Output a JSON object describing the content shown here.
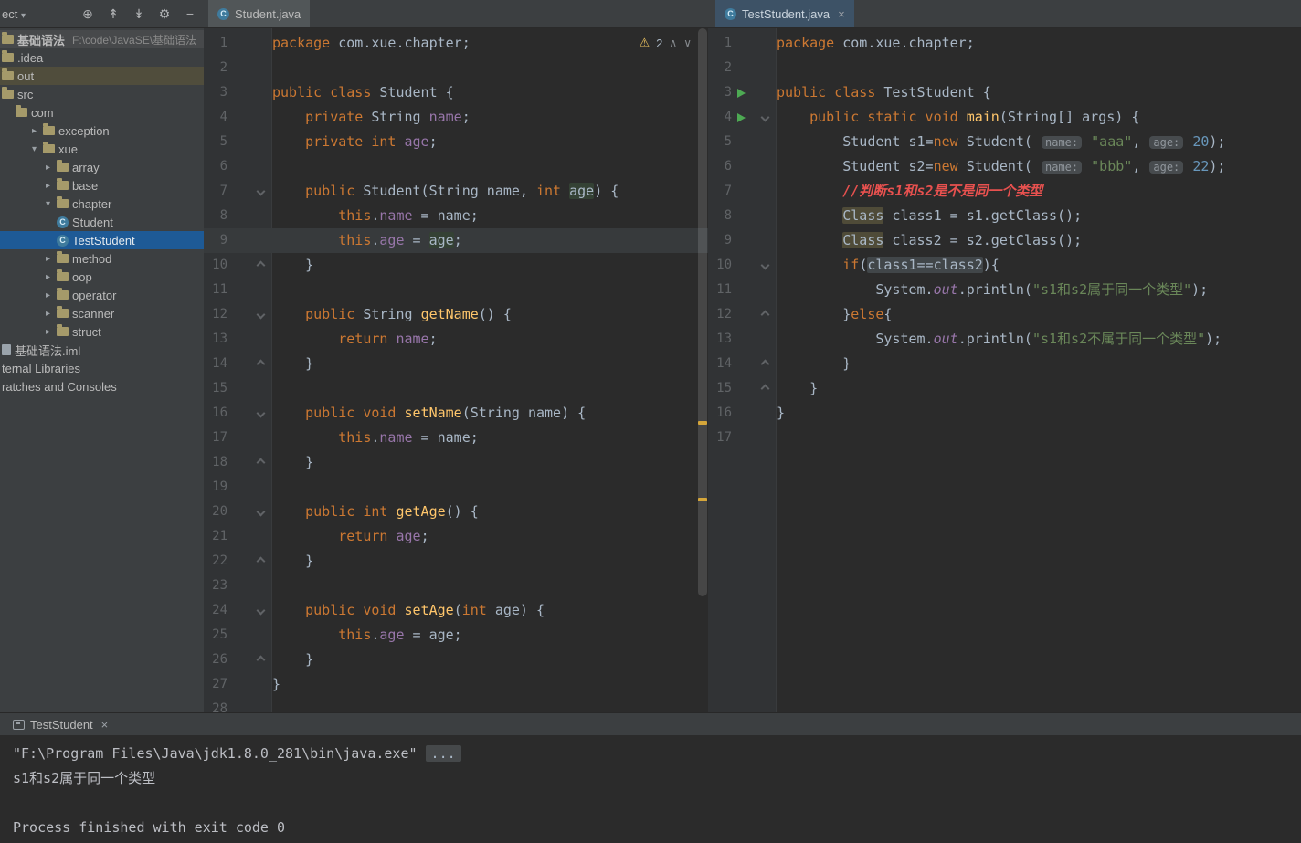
{
  "colors": {
    "editor_bg": "#2b2b2b",
    "panel_bg": "#3c3f41",
    "keyword": "#cc7832",
    "string": "#6a8759",
    "number": "#6897bb",
    "field": "#9876aa",
    "method": "#ffc66b",
    "comment_red": "#e8514f",
    "selection_blue": "#1e5a96",
    "run_green": "#4daa53",
    "warning_yellow": "#e8bf5e"
  },
  "project_panel": {
    "header": {
      "title": "ect",
      "caret": "▾",
      "icons": [
        {
          "name": "locate-icon",
          "glyph": "⊕"
        },
        {
          "name": "expand-all-icon",
          "glyph": "↟"
        },
        {
          "name": "collapse-all-icon",
          "glyph": "↡"
        },
        {
          "name": "settings-icon",
          "glyph": "⚙"
        },
        {
          "name": "hide-panel-icon",
          "glyph": "−"
        }
      ]
    },
    "tree": [
      {
        "label": "基础语法",
        "detail": "F:\\code\\JavaSE\\基础语法",
        "icon": "folder",
        "depth": 0,
        "bold": true,
        "style": "root-row"
      },
      {
        "label": ".idea",
        "icon": "folder",
        "depth": 0
      },
      {
        "label": "out",
        "icon": "folder",
        "depth": 0,
        "style": "out-row"
      },
      {
        "label": "src",
        "icon": "folder",
        "depth": 0
      },
      {
        "label": "com",
        "icon": "folder",
        "depth": 1
      },
      {
        "label": "exception",
        "icon": "folder",
        "depth": 2,
        "arrow": "closed"
      },
      {
        "label": "xue",
        "icon": "folder",
        "depth": 2,
        "arrow": "open"
      },
      {
        "label": "array",
        "icon": "folder",
        "depth": 3,
        "arrow": "closed"
      },
      {
        "label": "base",
        "icon": "folder",
        "depth": 3,
        "arrow": "closed"
      },
      {
        "label": "chapter",
        "icon": "folder",
        "depth": 3,
        "arrow": "open"
      },
      {
        "label": "Student",
        "icon": "class",
        "depth": 4
      },
      {
        "label": "TestStudent",
        "icon": "class",
        "depth": 4,
        "selected": true
      },
      {
        "label": "method",
        "icon": "folder",
        "depth": 3,
        "arrow": "closed"
      },
      {
        "label": "oop",
        "icon": "folder",
        "depth": 3,
        "arrow": "closed"
      },
      {
        "label": "operator",
        "icon": "folder",
        "depth": 3,
        "arrow": "closed"
      },
      {
        "label": "scanner",
        "icon": "folder",
        "depth": 3,
        "arrow": "closed"
      },
      {
        "label": "struct",
        "icon": "folder",
        "depth": 3,
        "arrow": "closed"
      },
      {
        "label": "基础语法.iml",
        "icon": "file",
        "depth": 0
      },
      {
        "label": "ternal Libraries",
        "icon": "none",
        "depth": 0
      },
      {
        "label": "ratches and Consoles",
        "icon": "none",
        "depth": 0
      }
    ]
  },
  "editor_tabs": {
    "left": {
      "label": "Student.java"
    },
    "right": {
      "label": "TestStudent.java",
      "close": "×"
    }
  },
  "editors": [
    {
      "id": "student",
      "inspections": {
        "icon": "⚠",
        "count": "2",
        "prev_icon": "∧",
        "next_icon": "∨"
      },
      "scroll_marks": [
        {
          "top": "57.4%",
          "color": "#d5a63a"
        },
        {
          "top": "68.6%",
          "color": "#d5a63a"
        }
      ],
      "lines": [
        {
          "n": 1,
          "tokens": [
            [
              "kw",
              "package"
            ],
            [
              "pl",
              " com.xue.chapter;"
            ]
          ]
        },
        {
          "n": 2,
          "tokens": []
        },
        {
          "n": 3,
          "tokens": [
            [
              "kw",
              "public class"
            ],
            [
              "pl",
              " Student {"
            ]
          ]
        },
        {
          "n": 4,
          "tokens": [
            [
              "pl",
              "    "
            ],
            [
              "kw",
              "private"
            ],
            [
              "pl",
              " String "
            ],
            [
              "fld",
              "name"
            ],
            [
              "pl",
              ";"
            ]
          ]
        },
        {
          "n": 5,
          "tokens": [
            [
              "pl",
              "    "
            ],
            [
              "kw",
              "private int"
            ],
            [
              "pl",
              " "
            ],
            [
              "fld",
              "age"
            ],
            [
              "pl",
              ";"
            ]
          ]
        },
        {
          "n": 6,
          "tokens": []
        },
        {
          "n": 7,
          "fold": "down",
          "tokens": [
            [
              "pl",
              "    "
            ],
            [
              "kw",
              "public"
            ],
            [
              "pl",
              " Student(String name, "
            ],
            [
              "kw",
              "int"
            ],
            [
              "pl",
              " "
            ],
            [
              "hl",
              "age"
            ],
            [
              "pl",
              ") {"
            ]
          ]
        },
        {
          "n": 8,
          "tokens": [
            [
              "pl",
              "        "
            ],
            [
              "kw",
              "this"
            ],
            [
              "pl",
              "."
            ],
            [
              "fld",
              "name"
            ],
            [
              "pl",
              " = name;"
            ]
          ]
        },
        {
          "n": 9,
          "caret": true,
          "tokens": [
            [
              "pl",
              "        "
            ],
            [
              "kw",
              "this"
            ],
            [
              "pl",
              "."
            ],
            [
              "fld",
              "age"
            ],
            [
              "pl",
              " = "
            ],
            [
              "hl",
              "age"
            ],
            [
              "pl",
              ";"
            ]
          ]
        },
        {
          "n": 10,
          "fold": "up",
          "tokens": [
            [
              "pl",
              "    }"
            ]
          ]
        },
        {
          "n": 11,
          "tokens": []
        },
        {
          "n": 12,
          "fold": "down",
          "tokens": [
            [
              "pl",
              "    "
            ],
            [
              "kw",
              "public"
            ],
            [
              "pl",
              " String "
            ],
            [
              "mth",
              "getName"
            ],
            [
              "pl",
              "() {"
            ]
          ]
        },
        {
          "n": 13,
          "tokens": [
            [
              "pl",
              "        "
            ],
            [
              "kw",
              "return"
            ],
            [
              "pl",
              " "
            ],
            [
              "fld",
              "name"
            ],
            [
              "pl",
              ";"
            ]
          ]
        },
        {
          "n": 14,
          "fold": "up",
          "tokens": [
            [
              "pl",
              "    }"
            ]
          ]
        },
        {
          "n": 15,
          "tokens": []
        },
        {
          "n": 16,
          "fold": "down",
          "tokens": [
            [
              "pl",
              "    "
            ],
            [
              "kw",
              "public void"
            ],
            [
              "pl",
              " "
            ],
            [
              "mth",
              "setName"
            ],
            [
              "pl",
              "(String name) {"
            ]
          ]
        },
        {
          "n": 17,
          "tokens": [
            [
              "pl",
              "        "
            ],
            [
              "kw",
              "this"
            ],
            [
              "pl",
              "."
            ],
            [
              "fld",
              "name"
            ],
            [
              "pl",
              " = name;"
            ]
          ]
        },
        {
          "n": 18,
          "fold": "up",
          "tokens": [
            [
              "pl",
              "    }"
            ]
          ]
        },
        {
          "n": 19,
          "tokens": []
        },
        {
          "n": 20,
          "fold": "down",
          "tokens": [
            [
              "pl",
              "    "
            ],
            [
              "kw",
              "public int"
            ],
            [
              "pl",
              " "
            ],
            [
              "mth",
              "getAge"
            ],
            [
              "pl",
              "() {"
            ]
          ]
        },
        {
          "n": 21,
          "tokens": [
            [
              "pl",
              "        "
            ],
            [
              "kw",
              "return"
            ],
            [
              "pl",
              " "
            ],
            [
              "fld",
              "age"
            ],
            [
              "pl",
              ";"
            ]
          ]
        },
        {
          "n": 22,
          "fold": "up",
          "tokens": [
            [
              "pl",
              "    }"
            ]
          ]
        },
        {
          "n": 23,
          "tokens": []
        },
        {
          "n": 24,
          "fold": "down",
          "tokens": [
            [
              "pl",
              "    "
            ],
            [
              "kw",
              "public void"
            ],
            [
              "pl",
              " "
            ],
            [
              "mth",
              "setAge"
            ],
            [
              "pl",
              "("
            ],
            [
              "kw",
              "int"
            ],
            [
              "pl",
              " age) {"
            ]
          ]
        },
        {
          "n": 25,
          "tokens": [
            [
              "pl",
              "        "
            ],
            [
              "kw",
              "this"
            ],
            [
              "pl",
              "."
            ],
            [
              "fld",
              "age"
            ],
            [
              "pl",
              " = age;"
            ]
          ]
        },
        {
          "n": 26,
          "fold": "up",
          "tokens": [
            [
              "pl",
              "    }"
            ]
          ]
        },
        {
          "n": 27,
          "tokens": [
            [
              "pl",
              "}"
            ]
          ]
        },
        {
          "n": 28,
          "tokens": []
        }
      ]
    },
    {
      "id": "teststudent",
      "lines": [
        {
          "n": 1,
          "tokens": [
            [
              "kw",
              "package"
            ],
            [
              "pl",
              " com.xue.chapter;"
            ]
          ]
        },
        {
          "n": 2,
          "tokens": []
        },
        {
          "n": 3,
          "run": true,
          "tokens": [
            [
              "kw",
              "public class"
            ],
            [
              "pl",
              " TestStudent {"
            ]
          ]
        },
        {
          "n": 4,
          "run": true,
          "fold": "down",
          "tokens": [
            [
              "pl",
              "    "
            ],
            [
              "kw",
              "public static void"
            ],
            [
              "pl",
              " "
            ],
            [
              "mth",
              "main"
            ],
            [
              "pl",
              "(String[] args) {"
            ]
          ]
        },
        {
          "n": 5,
          "tokens": [
            [
              "pl",
              "        Student s1="
            ],
            [
              "kw",
              "new"
            ],
            [
              "pl",
              " Student( "
            ],
            [
              "hint",
              "name:"
            ],
            [
              "pl",
              " "
            ],
            [
              "str",
              "\"aaa\""
            ],
            [
              "pl",
              ", "
            ],
            [
              "hint",
              "age:"
            ],
            [
              "pl",
              " "
            ],
            [
              "num",
              "20"
            ],
            [
              "pl",
              ");"
            ]
          ]
        },
        {
          "n": 6,
          "tokens": [
            [
              "pl",
              "        Student s2="
            ],
            [
              "kw",
              "new"
            ],
            [
              "pl",
              " Student( "
            ],
            [
              "hint",
              "name:"
            ],
            [
              "pl",
              " "
            ],
            [
              "str",
              "\"bbb\""
            ],
            [
              "pl",
              ", "
            ],
            [
              "hint",
              "age:"
            ],
            [
              "pl",
              " "
            ],
            [
              "num",
              "22"
            ],
            [
              "pl",
              ");"
            ]
          ]
        },
        {
          "n": 7,
          "tokens": [
            [
              "pl",
              "        "
            ],
            [
              "cmt",
              "//判断s1和s2是不是同一个类型"
            ]
          ]
        },
        {
          "n": 8,
          "tokens": [
            [
              "pl",
              "        "
            ],
            [
              "hlc",
              "Class"
            ],
            [
              "pl",
              " class1 = s1.getClass();"
            ]
          ]
        },
        {
          "n": 9,
          "tokens": [
            [
              "pl",
              "        "
            ],
            [
              "hlc",
              "Class"
            ],
            [
              "pl",
              " class2 = s2.getClass();"
            ]
          ]
        },
        {
          "n": 10,
          "fold": "down",
          "tokens": [
            [
              "pl",
              "        "
            ],
            [
              "kw",
              "if"
            ],
            [
              "pl",
              "("
            ],
            [
              "hls",
              "class1==class2"
            ],
            [
              "pl",
              "){"
            ]
          ]
        },
        {
          "n": 11,
          "tokens": [
            [
              "pl",
              "            System."
            ],
            [
              "out",
              "out"
            ],
            [
              "pl",
              ".println("
            ],
            [
              "str",
              "\"s1和s2属于同一个类型\""
            ],
            [
              "pl",
              ");"
            ]
          ]
        },
        {
          "n": 12,
          "fold": "up",
          "tokens": [
            [
              "pl",
              "        }"
            ],
            [
              "kw",
              "else"
            ],
            [
              "pl",
              "{"
            ]
          ]
        },
        {
          "n": 13,
          "tokens": [
            [
              "pl",
              "            System."
            ],
            [
              "out",
              "out"
            ],
            [
              "pl",
              ".println("
            ],
            [
              "str",
              "\"s1和s2不属于同一个类型\""
            ],
            [
              "pl",
              ");"
            ]
          ]
        },
        {
          "n": 14,
          "fold": "up",
          "tokens": [
            [
              "pl",
              "        }"
            ]
          ]
        },
        {
          "n": 15,
          "fold": "up",
          "tokens": [
            [
              "pl",
              "    }"
            ]
          ]
        },
        {
          "n": 16,
          "tokens": [
            [
              "pl",
              "}"
            ]
          ]
        },
        {
          "n": 17,
          "tokens": []
        }
      ]
    }
  ],
  "bottom_panel": {
    "tab": {
      "label": "TestStudent",
      "close": "×"
    },
    "console": [
      {
        "tokens": [
          [
            "pl",
            "\"F:\\Program Files\\Java\\jdk1.8.0_281\\bin\\java.exe\" "
          ],
          [
            "fold",
            "..."
          ]
        ]
      },
      {
        "tokens": [
          [
            "pl",
            "s1和s2属于同一个类型"
          ]
        ]
      },
      {
        "tokens": []
      },
      {
        "tokens": [
          [
            "pl",
            "Process finished with exit code 0"
          ]
        ]
      }
    ]
  }
}
